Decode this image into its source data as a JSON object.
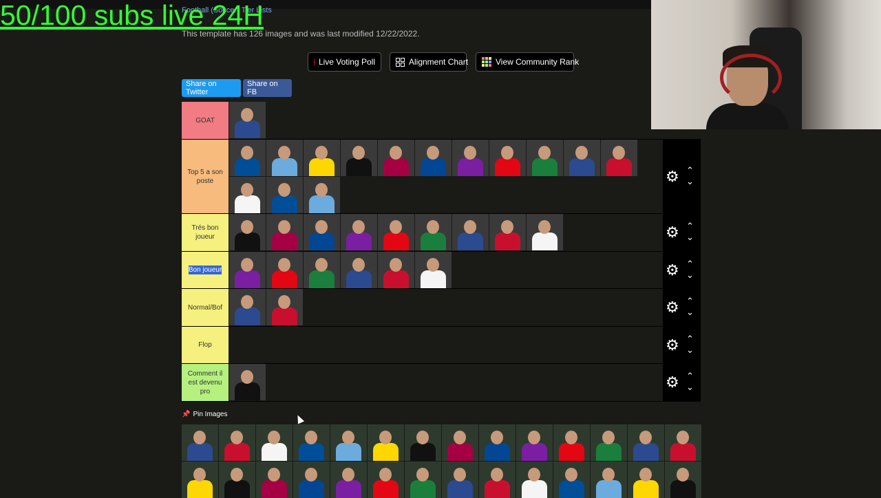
{
  "overlay": {
    "text": "50/100 subs live 24H"
  },
  "header": {
    "breadcrumb": "Football (Soccer) Tier Lists",
    "template_info": "This template has 126 images and was last modified 12/22/2022."
  },
  "actions": {
    "live_voting": "Live Voting Poll",
    "alignment_chart": "Alignment Chart",
    "community_rank": "View Community Rank"
  },
  "share": {
    "twitter": "Share on Twitter",
    "facebook": "Share on FB"
  },
  "tiers": [
    {
      "label": "GOAT",
      "color": "#f27c83",
      "count": 1
    },
    {
      "label": "Top 5 a son poste",
      "color": "#f7bb7e",
      "count": 14
    },
    {
      "label": "Trés bon joueur",
      "color": "#f6f07e",
      "count": 9
    },
    {
      "label": "Bon joueur",
      "color": "#f6f07e",
      "count": 6
    },
    {
      "label": "Normal/Bof",
      "color": "#f6f07e",
      "count": 2
    },
    {
      "label": "Flop",
      "color": "#f6f07e",
      "count": 0
    },
    {
      "label": "Comment il est devenu pro",
      "color": "#b6f07e",
      "count": 1
    }
  ],
  "pin_images": {
    "label": "Pin Images"
  },
  "colors": {
    "background": "#1a1a17",
    "overlay_text": "#33ff33",
    "twitter": "#1d9bf0",
    "facebook": "#3b5998",
    "live_dot": "#e3143f"
  },
  "icons": {
    "live": "red-dot-icon",
    "alignment": "grid-icon",
    "community": "rank-grid-icon",
    "settings": "gear-icon",
    "up": "chevron-up-icon",
    "down": "chevron-down-icon",
    "pin": "pin-icon"
  }
}
